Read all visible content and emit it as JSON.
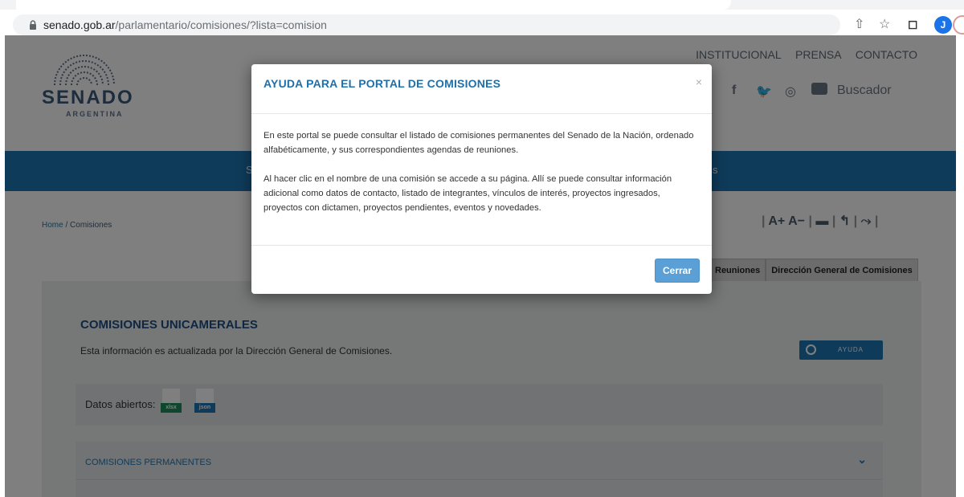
{
  "browser": {
    "url_host": "senado.gob.ar",
    "url_path": "/parlamentario/comisiones/?lista=comision",
    "avatar_letter": "J"
  },
  "site": {
    "logo_title": "SENADO",
    "logo_sub": "ARGENTINA",
    "topnav": [
      "INSTITUCIONAL",
      "PRENSA",
      "CONTACTO"
    ],
    "social": {
      "facebook": "f",
      "search_label": "Buscador"
    },
    "band_left": "S",
    "band_right": "s",
    "breadcrumb": {
      "home": "Home",
      "sep": "/",
      "current": "Comisiones"
    },
    "tools": {
      "font_up": "A+",
      "font_down": "A−"
    },
    "tabs": [
      "Reuniones",
      "Dirección General de Comisiones"
    ],
    "section_title": "COMISIONES UNICAMERALES",
    "section_sub": "Esta información es actualizada por la Dirección General de Comisiones.",
    "ayuda_label": "AYUDA",
    "datos_label": "Datos abiertos:",
    "files": [
      "xlsx",
      "json"
    ],
    "accordion_label": "COMISIONES PERMANENTES"
  },
  "modal": {
    "title": "AYUDA PARA EL PORTAL DE COMISIONES",
    "close_symbol": "×",
    "paragraph1": "En este portal se puede consultar el listado de comisiones permanentes del Senado de la Nación, ordenado alfabéticamente, y sus correspondientes agendas de reuniones.",
    "paragraph2": "Al hacer clic en el nombre de una comisión se accede a su página. Allí se puede consultar información adicional como datos de contacto, listado de integrantes, vínculos de interés, proyectos ingresados, proyectos con dictamen, proyectos pendientes, eventos y novedades.",
    "close_button": "Cerrar"
  },
  "colors": {
    "accent": "#1f77b4",
    "modal_title": "#1f6fa8",
    "button": "#5aa0d6",
    "xlsx": "#1d8f5a",
    "json": "#1f77b4"
  }
}
